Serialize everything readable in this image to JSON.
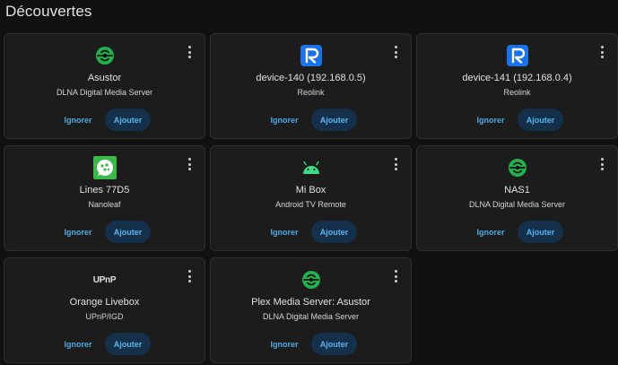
{
  "header": {
    "title": "Découvertes"
  },
  "colors": {
    "background": "#111111",
    "card": "#1c1c1c",
    "accent_text": "#4ea9e3",
    "add_button_bg": "#14304a",
    "dlna_green": "#23b14d",
    "reolink_blue": "#1a73e8",
    "nanoleaf_green": "#3bb84a",
    "android_green": "#3ddc84"
  },
  "cards": [
    {
      "name": "Asustor",
      "integration": "DLNA Digital Media Server",
      "icon": "dlna-icon",
      "ignore_label": "Ignorer",
      "add_label": "Ajouter"
    },
    {
      "name": "device-140 (192.168.0.5)",
      "integration": "Reolink",
      "icon": "reolink-icon",
      "ignore_label": "Ignorer",
      "add_label": "Ajouter"
    },
    {
      "name": "device-141 (192.168.0.4)",
      "integration": "Reolink",
      "icon": "reolink-icon",
      "ignore_label": "Ignorer",
      "add_label": "Ajouter"
    },
    {
      "name": "Lines 77D5",
      "integration": "Nanoleaf",
      "icon": "nanoleaf-icon",
      "ignore_label": "Ignorer",
      "add_label": "Ajouter"
    },
    {
      "name": "Mi Box",
      "integration": "Android TV Remote",
      "icon": "android-icon",
      "ignore_label": "Ignorer",
      "add_label": "Ajouter"
    },
    {
      "name": "NAS1",
      "integration": "DLNA Digital Media Server",
      "icon": "dlna-icon",
      "ignore_label": "Ignorer",
      "add_label": "Ajouter"
    },
    {
      "name": "Orange Livebox",
      "integration": "UPnP/IGD",
      "icon": "upnp-icon",
      "logo_text": "UPnP",
      "ignore_label": "Ignorer",
      "add_label": "Ajouter"
    },
    {
      "name": "Plex Media Server: Asustor",
      "integration": "DLNA Digital Media Server",
      "icon": "dlna-icon",
      "ignore_label": "Ignorer",
      "add_label": "Ajouter"
    }
  ]
}
